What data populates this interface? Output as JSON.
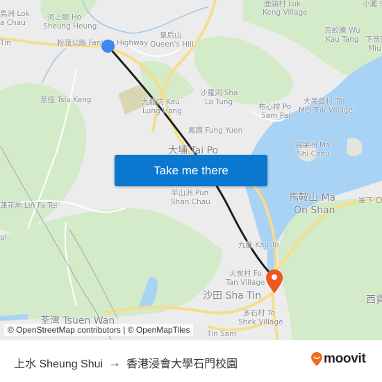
{
  "map": {
    "labels": [
      {
        "id": "lok-ma-chau-1",
        "text": "馬洲 Lok"
      },
      {
        "id": "lok-ma-chau-2",
        "text": "a Chau"
      },
      {
        "id": "tin",
        "text": "Tin"
      },
      {
        "id": "ho-sheung-heung-1",
        "text": "河上鄉 Ho"
      },
      {
        "id": "ho-sheung-heung-2",
        "text": "Sheung Heung"
      },
      {
        "id": "fanling-highway",
        "text": "粉嶺公路 Fanling Highway"
      },
      {
        "id": "queens-hill-1",
        "text": "皇后山"
      },
      {
        "id": "queens-hill-2",
        "text": "Queen's Hill"
      },
      {
        "id": "luk-keng-1",
        "text": "鹿頸村 Luk"
      },
      {
        "id": "luk-keng-2",
        "text": "Keng Village"
      },
      {
        "id": "siu-tan",
        "text": "小灘 S"
      },
      {
        "id": "wu-kau-tang-1",
        "text": "烏蛟騰 Wu"
      },
      {
        "id": "wu-kau-tang-2",
        "text": "Kau Tang"
      },
      {
        "id": "miu-1",
        "text": "下苗田"
      },
      {
        "id": "miu-2",
        "text": "Miu"
      },
      {
        "id": "tsiu-keng",
        "text": "蕉徑 Tsiu Keng"
      },
      {
        "id": "sha-lo-tung-1",
        "text": "沙羅洞 Sha"
      },
      {
        "id": "sha-lo-tung-2",
        "text": "Lo Tung"
      },
      {
        "id": "kau-lung-hang-1",
        "text": "九龍坑 Kau"
      },
      {
        "id": "kau-lung-hang-2",
        "text": "Lung Hang"
      },
      {
        "id": "po-sam-pai-1",
        "text": "布心排 Po"
      },
      {
        "id": "po-sam-pai-2",
        "text": "Sam Pai"
      },
      {
        "id": "tai-mei-tuk-1",
        "text": "大美督村 Tai"
      },
      {
        "id": "tai-mei-tuk-2",
        "text": "Mei Tuk Village"
      },
      {
        "id": "fung-yuen",
        "text": "鳳園 Fung Yuen"
      },
      {
        "id": "tai-po",
        "text": "大埔 Tai Po"
      },
      {
        "id": "ma-shi-chau-1",
        "text": "馬屎洲 Ma"
      },
      {
        "id": "ma-shi-chau-2",
        "text": "Shi Chau"
      },
      {
        "id": "pun-shan-chau-1",
        "text": "半山洲 Pun"
      },
      {
        "id": "pun-shan-chau-2",
        "text": "Shan Chau"
      },
      {
        "id": "lin-fa-tei",
        "text": "蓮花地 Lin Fa Tei"
      },
      {
        "id": "ma-on-shan-1",
        "text": "馬鞍山 Ma"
      },
      {
        "id": "ma-on-shan-2",
        "text": "On Shan"
      },
      {
        "id": "kei-ha",
        "text": "崋下 Ch"
      },
      {
        "id": "kau-to",
        "text": "九肚 Kau To"
      },
      {
        "id": "fo-tan-1",
        "text": "火炭村 Fo"
      },
      {
        "id": "fo-tan-2",
        "text": "Tan Village"
      },
      {
        "id": "sha-tin",
        "text": "沙田 Sha Tin"
      },
      {
        "id": "to-shek-1",
        "text": "多石村 To"
      },
      {
        "id": "to-shek-2",
        "text": "Shek Village"
      },
      {
        "id": "sai-kung",
        "text": "西貢"
      },
      {
        "id": "tsuen-wan",
        "text": "荃灣 Tsuen Wan"
      },
      {
        "id": "tin-sam",
        "text": "Tin Sam"
      },
      {
        "id": "ui",
        "text": "ui"
      }
    ],
    "cta_label": "Take me there",
    "attribution": "© OpenStreetMap contributors | © OpenMapTiles",
    "colors": {
      "land": "#ececec",
      "park": "#cfe8c4",
      "water": "#a9d3f5",
      "road": "#f6dd8a",
      "route": "#1f1f1f",
      "origin": "#3d86f6",
      "destination": "#f0561f",
      "cta": "#0b78d0"
    }
  },
  "footer": {
    "origin": "上水 Sheung Shui",
    "arrow": "→",
    "destination": "香港浸會大學石門校園",
    "brand": "moovit",
    "brand_color": "#f26b21"
  }
}
